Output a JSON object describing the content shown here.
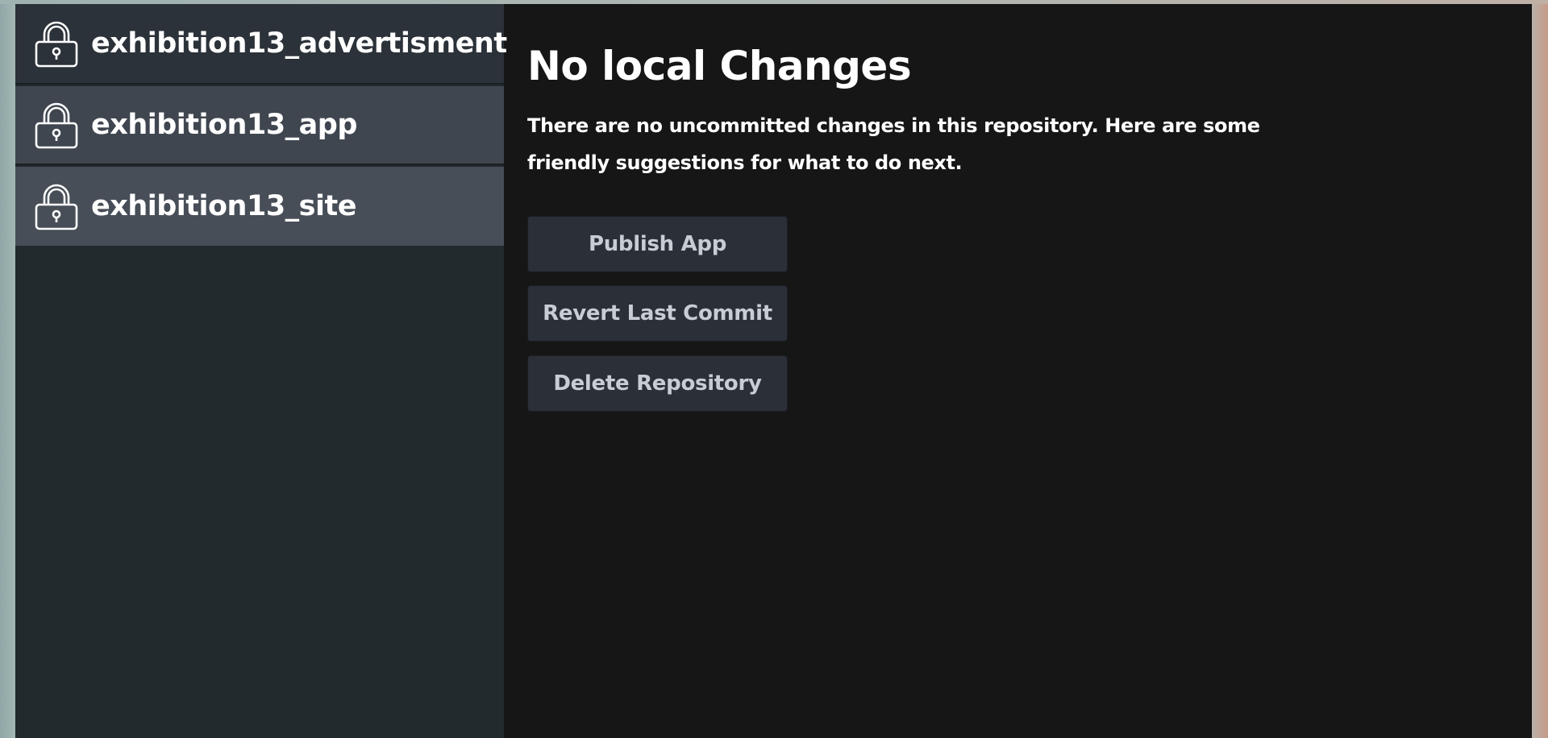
{
  "sidebar": {
    "repositories": [
      {
        "name": "exhibition13_advertisment",
        "icon": "lock-icon"
      },
      {
        "name": "exhibition13_app",
        "icon": "lock-icon"
      },
      {
        "name": "exhibition13_site",
        "icon": "lock-icon"
      }
    ]
  },
  "main": {
    "title": "No local Changes",
    "description": "There are no uncommitted changes in this repository. Here are some friendly suggestions for what to do next.",
    "actions": {
      "publish_label": "Publish App",
      "revert_label": "Revert Last Commit",
      "delete_label": "Delete Repository"
    }
  },
  "colors": {
    "window_bg": "#161616",
    "sidebar_bg": "#212a2d",
    "button_bg": "#2a2f38",
    "button_text": "#c8cdd3",
    "text": "#ffffff"
  }
}
